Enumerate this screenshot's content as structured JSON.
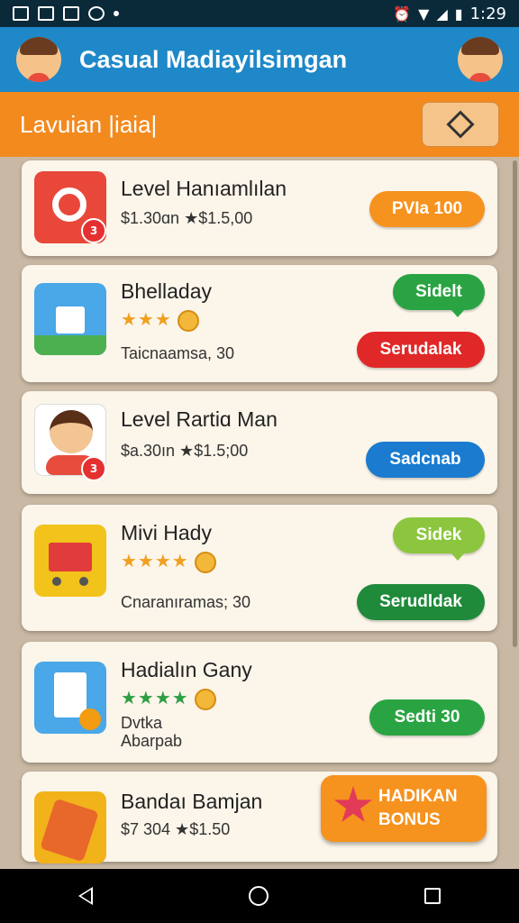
{
  "status_bar": {
    "time": "1:29"
  },
  "app_bar": {
    "title": "Casual Madiayilsimgan"
  },
  "subbar": {
    "title": "Lavuian |iaia|"
  },
  "items": [
    {
      "title": "Level Hanıamlılan",
      "sub": "$1.30ɑn ★$1.5,00",
      "button": "PVIa 100",
      "badge": "3"
    },
    {
      "title": "Bhelladay",
      "stars": "★★★",
      "sub": "Taicnaamsa, 30",
      "button_top": "Sidelt",
      "button": "Serudalak"
    },
    {
      "title": "Level Rartiɑ Man",
      "sub": "$a.30ın ★$1.5;00",
      "button": "Sadcnab",
      "badge": "3"
    },
    {
      "title": "Mivi Hady",
      "stars": "★★★★",
      "sub": "Cnaranıramas; 30",
      "button_top": "Sidek",
      "button": "Serudldak"
    },
    {
      "title": "Hadialın Gany",
      "stars": "★★★★",
      "sub1": "Dvtka",
      "sub2": "Abarpab",
      "button": "Sedti 30"
    },
    {
      "title": "Bandaı Bamjan",
      "sub": "$7 304 ★$1.50"
    }
  ],
  "bonus": {
    "line1": "HADIKAN",
    "line2": "BONUS"
  },
  "colors": {
    "app_bar": "#1e88c8",
    "subbar": "#f38a1e",
    "list_bg": "#c9b8a3"
  }
}
